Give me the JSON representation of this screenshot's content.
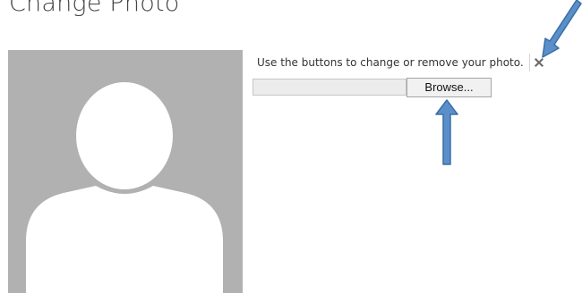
{
  "dialog": {
    "title": "Change Photo",
    "instructions": "Use the buttons to change or remove your photo.",
    "browse_label": "Browse...",
    "file_path_value": ""
  },
  "icons": {
    "remove": "close-icon",
    "placeholder": "person-silhouette-icon",
    "annotation": "arrow-icon"
  },
  "colors": {
    "avatar_background": "#b1b1b1",
    "silhouette": "#ffffff",
    "arrow_fill": "#5b8fc9",
    "arrow_stroke": "#3a6ea5"
  }
}
